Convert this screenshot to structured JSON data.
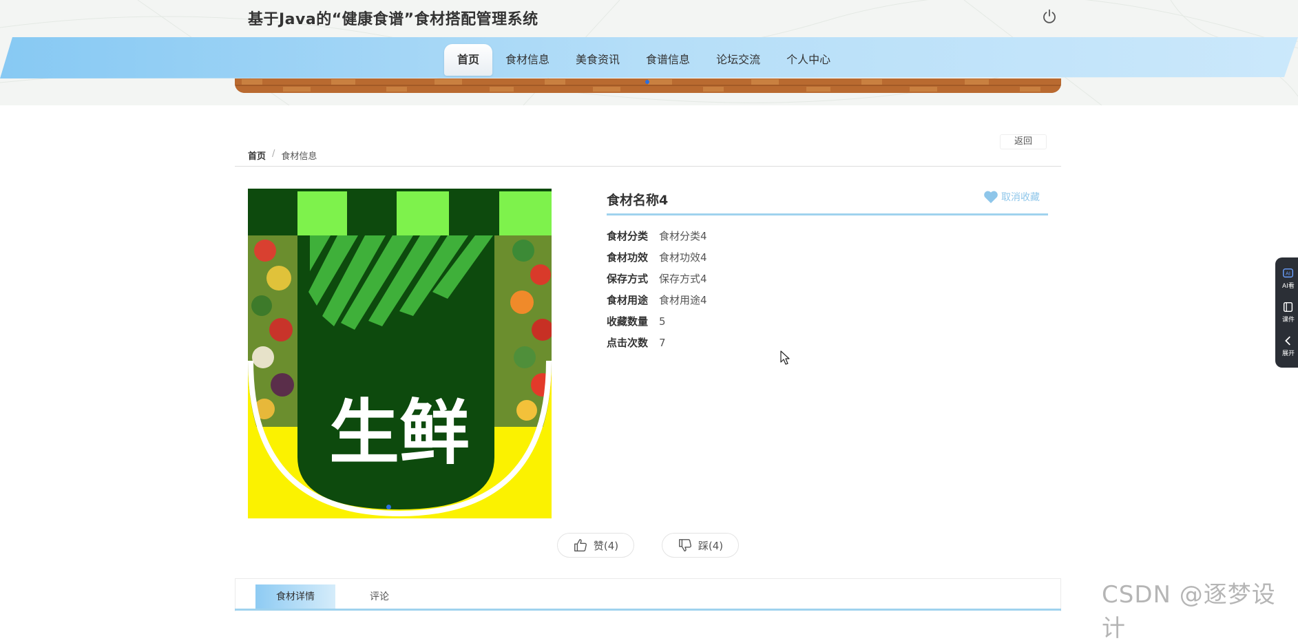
{
  "header": {
    "site_title": "基于Java的“健康食谱”食材搭配管理系统",
    "nav": [
      {
        "label": "首页",
        "active": true
      },
      {
        "label": "食材信息",
        "active": false
      },
      {
        "label": "美食资讯",
        "active": false
      },
      {
        "label": "食谱信息",
        "active": false
      },
      {
        "label": "论坛交流",
        "active": false
      },
      {
        "label": "个人中心",
        "active": false
      }
    ]
  },
  "breadcrumb": {
    "home": "首页",
    "separator": "/",
    "current": "食材信息",
    "back_label": "返回"
  },
  "product": {
    "image_text": "生鲜",
    "name": "食材名称4",
    "favorite_label": "取消收藏",
    "attributes": [
      {
        "label": "食材分类",
        "value": "食材分类4"
      },
      {
        "label": "食材功效",
        "value": "食材功效4"
      },
      {
        "label": "保存方式",
        "value": "保存方式4"
      },
      {
        "label": "食材用途",
        "value": "食材用途4"
      },
      {
        "label": "收藏数量",
        "value": "5"
      },
      {
        "label": "点击次数",
        "value": "7"
      }
    ],
    "like_label": "赞(4)",
    "dislike_label": "踩(4)"
  },
  "tabs": [
    {
      "label": "食材详情",
      "active": true
    },
    {
      "label": "评论",
      "active": false
    }
  ],
  "side_panel": {
    "items": [
      {
        "label": "AI看",
        "icon": "ai-icon"
      },
      {
        "label": "课件",
        "icon": "courseware-icon"
      },
      {
        "label": "展开",
        "icon": "chevron-left-icon"
      }
    ]
  },
  "watermark": "CSDN @逐梦设计",
  "colors": {
    "accent": "#9fd2ee",
    "nav_band": "#8fcff5",
    "favorite": "#8ec6ea",
    "image_green_dark": "#0d4a0d",
    "image_green_light": "#7ef24c",
    "image_yellow": "#fbf200"
  }
}
